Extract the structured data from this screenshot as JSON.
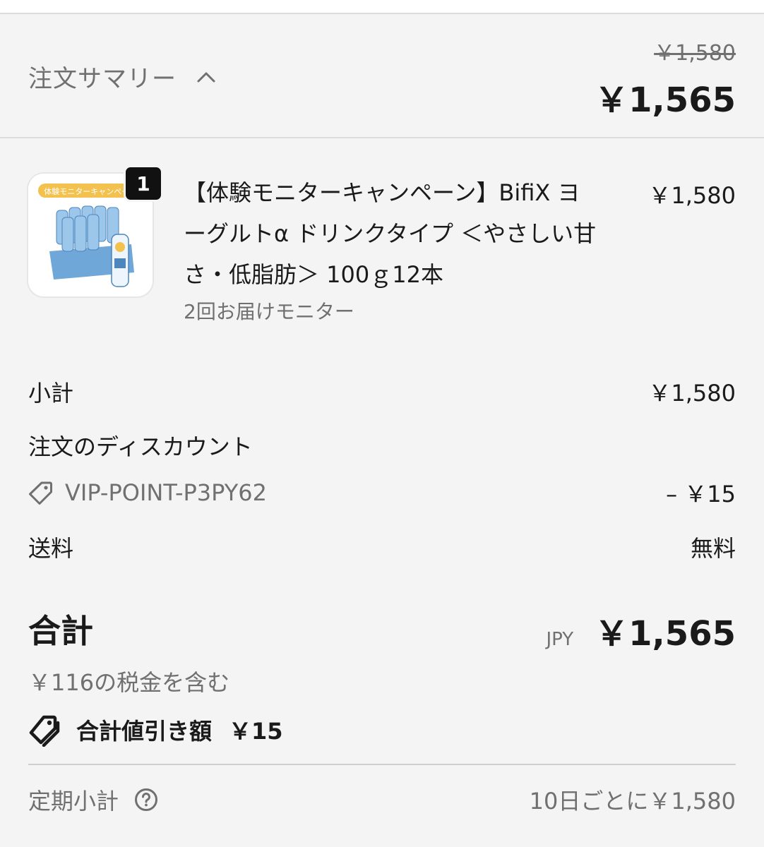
{
  "header": {
    "summary_label": "注文サマリー",
    "original_total": "￥1,580",
    "total": "￥1,565"
  },
  "product": {
    "quantity": "1",
    "name": "【体験モニターキャンペーン】BifiX ヨーグルトα ドリンクタイプ ＜やさしい甘さ・低脂肪＞ 100ｇ12本",
    "variant": "2回お届けモニター",
    "price": "￥1,580",
    "image_banner_text": "体験モニターキャンペーン"
  },
  "summary": {
    "subtotal_label": "小計",
    "subtotal_value": "￥1,580",
    "discount_label": "注文のディスカウント",
    "discount_code": "VIP-POINT-P3PY62",
    "discount_value": "– ￥15",
    "shipping_label": "送料",
    "shipping_value": "無料"
  },
  "total": {
    "label": "合計",
    "currency": "JPY",
    "amount": "￥1,565",
    "tax_note": "￥116の税金を含む",
    "savings_label": "合計値引き額",
    "savings_amount": "￥15"
  },
  "recurring": {
    "label": "定期小計",
    "value": "10日ごとに￥1,580"
  },
  "colors": {
    "background": "#f4f4f4",
    "text": "#1a1a1a",
    "muted": "#707070",
    "badge": "#111111"
  }
}
